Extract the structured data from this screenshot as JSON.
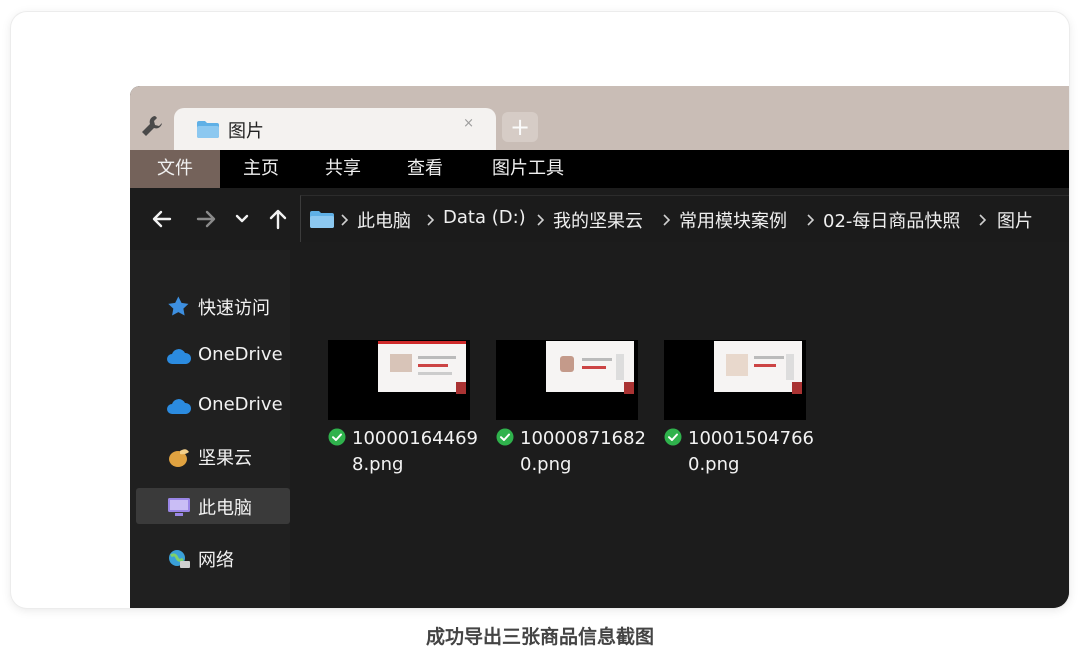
{
  "tab": {
    "title": "图片",
    "close_glyph": "×",
    "new_tab_glyph": "+"
  },
  "ribbon": [
    {
      "label": "文件",
      "key": "file"
    },
    {
      "label": "主页",
      "key": "home"
    },
    {
      "label": "共享",
      "key": "share"
    },
    {
      "label": "查看",
      "key": "view"
    },
    {
      "label": "图片工具",
      "key": "picture-tools"
    }
  ],
  "breadcrumbs": [
    "此电脑",
    "Data (D:)",
    "我的坚果云",
    "常用模块案例",
    "02-每日商品快照",
    "图片"
  ],
  "sidebar": [
    {
      "label": "快速访问",
      "icon": "star-icon"
    },
    {
      "label": "OneDrive",
      "icon": "cloud-icon"
    },
    {
      "label": "OneDrive",
      "icon": "cloud-icon"
    },
    {
      "label": "坚果云",
      "icon": "nut-icon"
    },
    {
      "label": "此电脑",
      "icon": "computer-icon",
      "selected": true
    },
    {
      "label": "网络",
      "icon": "network-icon"
    }
  ],
  "files": [
    {
      "line1": "10000164469",
      "line2": "8.png",
      "status": "synced"
    },
    {
      "line1": "10000871682",
      "line2": "0.png",
      "status": "synced"
    },
    {
      "line1": "10001504766",
      "line2": "0.png",
      "status": "synced"
    }
  ],
  "caption": "成功导出三张商品信息截图",
  "colors": {
    "accent_folder": "#5fb0e6",
    "sync_green": "#2fb24c",
    "ribbon_active": "#74625a"
  }
}
